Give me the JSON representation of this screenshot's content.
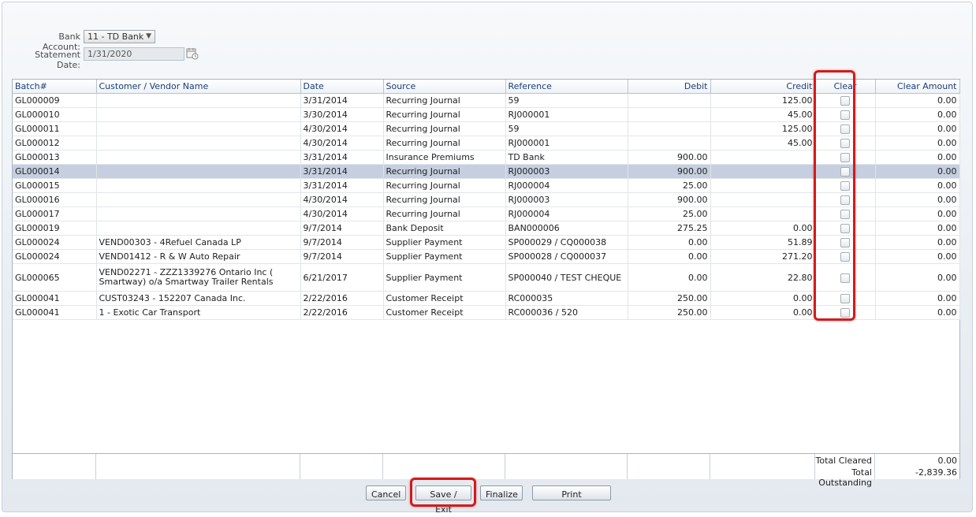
{
  "form": {
    "bank_account_label": "Bank Account:",
    "bank_account_value": "11 - TD Bank",
    "statement_date_label": "Statement Date:",
    "statement_date_value": "1/31/2020"
  },
  "columns": [
    "Batch#",
    "Customer / Vendor Name",
    "Date",
    "Source",
    "Reference",
    "Debit",
    "Credit",
    "Clear",
    "Clear Amount"
  ],
  "rows": [
    {
      "batch": "GL000009",
      "name": "",
      "date": "3/31/2014",
      "source": "Recurring Journal",
      "reference": "59",
      "debit": "",
      "credit": "125.00",
      "clear_amount": "0.00"
    },
    {
      "batch": "GL000010",
      "name": "",
      "date": "3/30/2014",
      "source": "Recurring Journal",
      "reference": "RJ000001",
      "debit": "",
      "credit": "45.00",
      "clear_amount": "0.00"
    },
    {
      "batch": "GL000011",
      "name": "",
      "date": "4/30/2014",
      "source": "Recurring Journal",
      "reference": "59",
      "debit": "",
      "credit": "125.00",
      "clear_amount": "0.00"
    },
    {
      "batch": "GL000012",
      "name": "",
      "date": "4/30/2014",
      "source": "Recurring Journal",
      "reference": "RJ000001",
      "debit": "",
      "credit": "45.00",
      "clear_amount": "0.00"
    },
    {
      "batch": "GL000013",
      "name": "",
      "date": "3/31/2014",
      "source": "Insurance Premiums",
      "reference": "TD Bank",
      "debit": "900.00",
      "credit": "",
      "clear_amount": "0.00"
    },
    {
      "batch": "GL000014",
      "name": "",
      "date": "3/31/2014",
      "source": "Recurring Journal",
      "reference": "RJ000003",
      "debit": "900.00",
      "credit": "",
      "clear_amount": "0.00"
    },
    {
      "batch": "GL000015",
      "name": "",
      "date": "3/31/2014",
      "source": "Recurring Journal",
      "reference": "RJ000004",
      "debit": "25.00",
      "credit": "",
      "clear_amount": "0.00"
    },
    {
      "batch": "GL000016",
      "name": "",
      "date": "4/30/2014",
      "source": "Recurring Journal",
      "reference": "RJ000003",
      "debit": "900.00",
      "credit": "",
      "clear_amount": "0.00"
    },
    {
      "batch": "GL000017",
      "name": "",
      "date": "4/30/2014",
      "source": "Recurring Journal",
      "reference": "RJ000004",
      "debit": "25.00",
      "credit": "",
      "clear_amount": "0.00"
    },
    {
      "batch": "GL000019",
      "name": "",
      "date": "9/7/2014",
      "source": "Bank Deposit",
      "reference": "BAN000006",
      "debit": "275.25",
      "credit": "0.00",
      "clear_amount": "0.00"
    },
    {
      "batch": "GL000024",
      "name": "VEND00303 - 4Refuel Canada LP",
      "date": "9/7/2014",
      "source": "Supplier Payment",
      "reference": "SP000029 / CQ000038",
      "debit": "0.00",
      "credit": "51.89",
      "clear_amount": "0.00"
    },
    {
      "batch": "GL000024",
      "name": "VEND01412 - R & W Auto Repair",
      "date": "9/7/2014",
      "source": "Supplier Payment",
      "reference": "SP000028 / CQ000037",
      "debit": "0.00",
      "credit": "271.20",
      "clear_amount": "0.00"
    },
    {
      "batch": "GL000065",
      "name": "VEND02271 - ZZZ1339276 Ontario Inc ( Smartway) o/a Smartway Trailer Rentals",
      "date": "6/21/2017",
      "source": "Supplier Payment",
      "reference": "SP000040 / TEST CHEQUE",
      "debit": "0.00",
      "credit": "22.80",
      "clear_amount": "0.00"
    },
    {
      "batch": "GL000041",
      "name": "CUST03243 - 152207 Canada Inc.",
      "date": "2/22/2016",
      "source": "Customer Receipt",
      "reference": "RC000035",
      "debit": "250.00",
      "credit": "0.00",
      "clear_amount": "0.00"
    },
    {
      "batch": "GL000041",
      "name": "1 - Exotic Car Transport",
      "date": "2/22/2016",
      "source": "Customer Receipt",
      "reference": "RC000036 / 520",
      "debit": "250.00",
      "credit": "0.00",
      "clear_amount": "0.00"
    }
  ],
  "selected_row_index": 5,
  "totals": {
    "cleared_label": "Total Cleared",
    "cleared_value": "0.00",
    "outstanding_label": "Total Outstanding",
    "outstanding_value": "-2,839.36"
  },
  "buttons": {
    "cancel": "Cancel",
    "save_exit": "Save / Exit",
    "finalize": "Finalize",
    "print": "Print"
  },
  "icons": {
    "calendar": "calendar-icon",
    "dropdown": "chevron-down-icon"
  },
  "colors": {
    "highlight": "#d41a1a",
    "selected_row": "#c5cfe0",
    "header_text": "#1a3d7a"
  }
}
